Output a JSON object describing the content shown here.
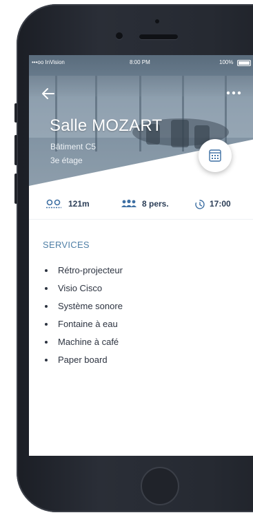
{
  "status_bar": {
    "carrier": "•••oo InVision",
    "time": "8:00 PM",
    "battery": "100%"
  },
  "room": {
    "name": "Salle MOZART",
    "building": "Bâtiment C5",
    "floor": "3e étage"
  },
  "info": {
    "distance": "121m",
    "capacity": "8 pers.",
    "time": "17:00"
  },
  "services": {
    "title": "SERVICES",
    "items": [
      "Rétro-projecteur",
      "Visio Cisco",
      "Système sonore",
      "Fontaine à eau",
      "Machine à café",
      "Paper board"
    ]
  },
  "colors": {
    "accent": "#4f7fa6",
    "text_dark": "#2c3e57",
    "icon_blue": "#3d6fa3"
  },
  "icons": {
    "back": "arrow-left-icon",
    "more": "more-dots-icon",
    "calendar": "calendar-icon",
    "distance": "location-pin-icon",
    "capacity": "people-icon",
    "time": "clock-icon"
  }
}
